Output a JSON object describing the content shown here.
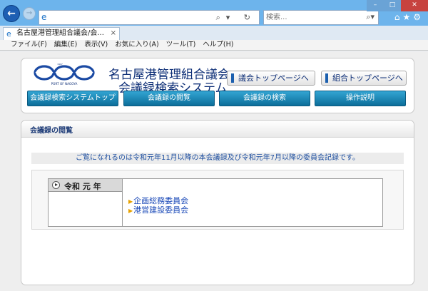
{
  "browser": {
    "nav": {
      "back_icon": "arrow-left-icon",
      "forward_icon": "arrow-right-icon"
    },
    "address": {
      "value": "",
      "icons": "search-icon refresh-icon"
    },
    "search": {
      "placeholder": "検索..."
    },
    "tab": {
      "title": "名古屋港管理組合議会/会..."
    },
    "menu": [
      "ファイル(F)",
      "編集(E)",
      "表示(V)",
      "お気に入り(A)",
      "ツール(T)",
      "ヘルプ(H)"
    ]
  },
  "header": {
    "logo_caption": "PORT OF NAGOYA",
    "title_line1": "名古屋港管理組合議会",
    "title_line2": "会議録検索システム",
    "assembly_link": "議会トップページへ",
    "union_link": "組合トップページへ"
  },
  "navbar": {
    "items": [
      "会議録検索システムトップ",
      "会議録の閲覧",
      "会議録の検索",
      "操作説明"
    ]
  },
  "content": {
    "title": "会議録の閲覧",
    "notice": "ご覧になれるのは令和元年11月以降の本会議録及び令和元年7月以降の委員会記録です。",
    "year": "令和 元 年",
    "committees": [
      "企画総務委員会",
      "港営建設委員会"
    ]
  },
  "colors": {
    "accent": "#0e2f77",
    "nav_tab": "#1a88b8",
    "link": "#1a49b8"
  }
}
